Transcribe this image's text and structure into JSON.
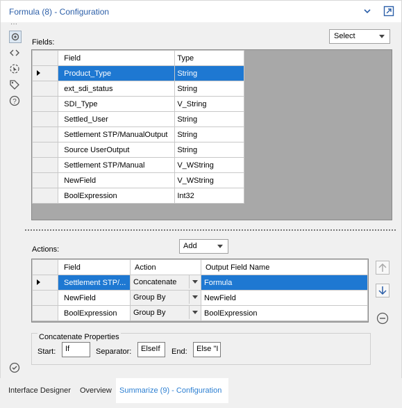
{
  "window": {
    "title": "Formula (8) - Configuration"
  },
  "fields": {
    "label": "Fields:",
    "select_dropdown": "Select",
    "columns": [
      "Field",
      "Type"
    ],
    "rows": [
      {
        "field": "Product_Type",
        "type": "String"
      },
      {
        "field": "ext_sdi_status",
        "type": "String"
      },
      {
        "field": "SDI_Type",
        "type": "V_String"
      },
      {
        "field": "Settled_User",
        "type": "String"
      },
      {
        "field": "Settlement STP/ManualOutput",
        "type": "String"
      },
      {
        "field": "Source UserOutput",
        "type": "String"
      },
      {
        "field": "Settlement STP/Manual",
        "type": "V_WString"
      },
      {
        "field": "NewField",
        "type": "V_WString"
      },
      {
        "field": "BoolExpression",
        "type": "Int32"
      }
    ]
  },
  "actions": {
    "label": "Actions:",
    "add_dropdown": "Add",
    "columns": [
      "Field",
      "Action",
      "Output Field Name"
    ],
    "rows": [
      {
        "field": "Settlement STP/...",
        "action": "Concatenate",
        "output": "Formula"
      },
      {
        "field": "NewField",
        "action": "Group By",
        "output": "NewField"
      },
      {
        "field": "BoolExpression",
        "action": "Group By",
        "output": "BoolExpression"
      }
    ]
  },
  "concat": {
    "title": "Concatenate Properties",
    "start_label": "Start:",
    "start_value": "If",
    "separator_label": "Separator:",
    "separator_value": "ElseIf",
    "end_label": "End:",
    "end_value": "Else \"I"
  },
  "tabs": [
    "Interface Designer",
    "Overview",
    "Summarize (9) - Configuration"
  ],
  "colors": {
    "accent": "#1e78d2",
    "title": "#2c5fa8",
    "grid_bg": "#a8a8a8"
  }
}
